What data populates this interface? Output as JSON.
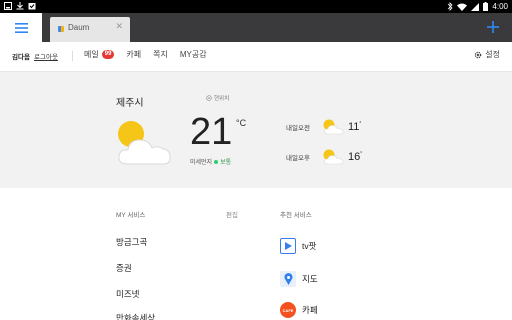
{
  "status_bar": {
    "time": "4:00",
    "left_icons": [
      "screenshot-icon",
      "download-icon",
      "calendar-icon"
    ],
    "right_icons": [
      "bluetooth-icon",
      "wifi-icon",
      "signal-icon",
      "battery-icon"
    ]
  },
  "tabs": {
    "menu_icon": "hamburger-icon",
    "items": [
      {
        "title": "Daum",
        "favicon": "daum-favicon"
      }
    ],
    "new_tab_icon": "plus-icon"
  },
  "nav": {
    "user_name": "김다음",
    "logout_label": "로그아웃",
    "items": [
      {
        "label": "메일",
        "badge": "99"
      },
      {
        "label": "카페"
      },
      {
        "label": "쪽지"
      },
      {
        "label": "MY공감"
      }
    ],
    "settings_label": "설정"
  },
  "weather": {
    "city": "제주시",
    "location_label": "현위치",
    "temperature": "21",
    "unit": "°C",
    "dust_label": "미세먼지",
    "dust_value": "보통",
    "forecast": [
      {
        "label": "내일오전",
        "temp": "11",
        "deg": "°",
        "icon": "partly-cloudy-icon"
      },
      {
        "label": "내일오후",
        "temp": "16",
        "deg": "°",
        "icon": "partly-cloudy-icon"
      }
    ],
    "main_icon": "partly-cloudy-icon"
  },
  "my_services": {
    "title": "MY 서비스",
    "edit_label": "편집",
    "items": [
      "방금그곡",
      "증권",
      "미즈넷",
      "만화속세상"
    ]
  },
  "recommended": {
    "title": "추천 서비스",
    "items": [
      {
        "label": "tv팟",
        "icon": "tvpot-icon",
        "color": "#3b7ded"
      },
      {
        "label": "지도",
        "icon": "map-pin-icon",
        "color": "#2f80ed"
      },
      {
        "label": "카페",
        "icon": "cafe-icon",
        "color": "#f4511e"
      }
    ]
  },
  "colors": {
    "accent": "#2f87f5",
    "tabbar": "#3a3a3c",
    "weather_bg": "#f2f2f2",
    "badge": "#e53935"
  }
}
